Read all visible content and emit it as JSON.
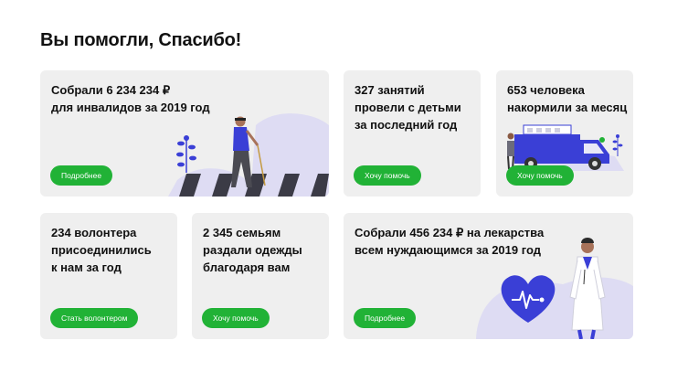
{
  "page": {
    "title": "Вы помогли, Спасибо!"
  },
  "cards": [
    {
      "text": "Собрали 6 234 234 ₽\nдля инвалидов за 2019 год",
      "button": "Подробнее",
      "illustration": "blind-man-crosswalk"
    },
    {
      "text": "327 занятий\nпровели с детьми\nза последний год",
      "button": "Хочу помочь"
    },
    {
      "text": "653 человека\nнакормили за месяц",
      "button": "Хочу помочь",
      "illustration": "food-truck"
    },
    {
      "text": "234 волонтера\nприсоединились\nк нам за год",
      "button": "Стать волонтером"
    },
    {
      "text": "2 345 семьям\nраздали одежды\nблагодаря вам",
      "button": "Хочу помочь"
    },
    {
      "text": "Собрали 456 234 ₽ на лекарства\nвсем нуждающимся за 2019 год",
      "button": "Подробнее",
      "illustration": "doctor-heart"
    }
  ],
  "colors": {
    "accent": "#21b236",
    "card_bg": "#efefef",
    "illustration_blue": "#3a3fd6",
    "illustration_lilac": "#dedcf3"
  }
}
